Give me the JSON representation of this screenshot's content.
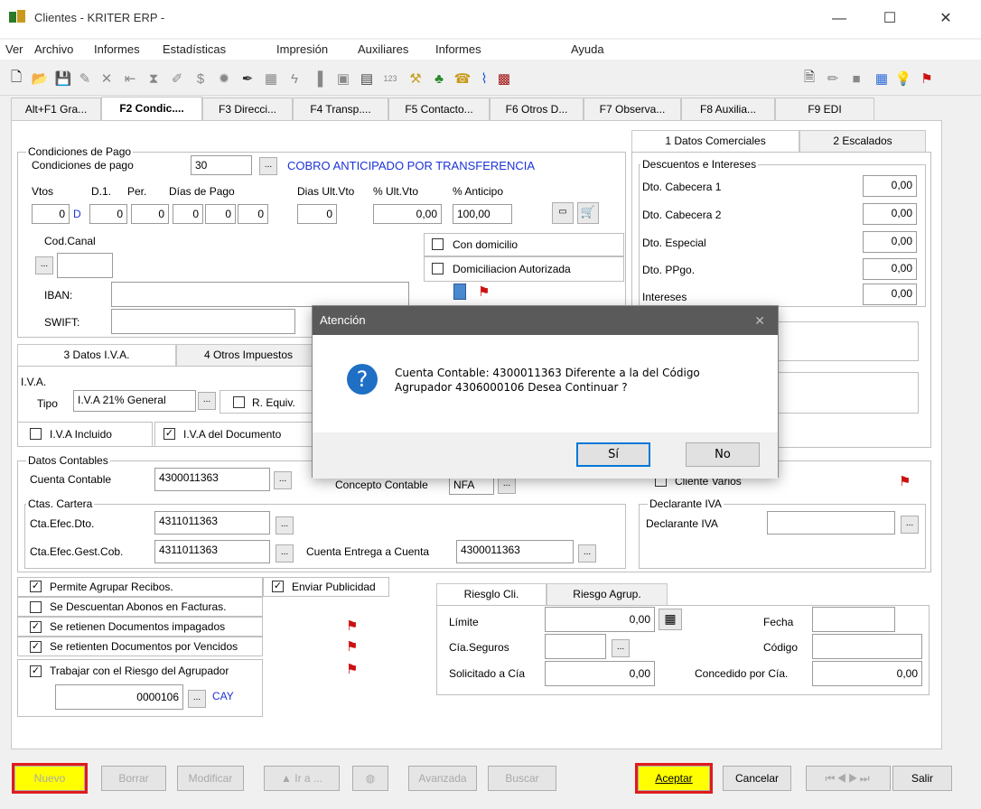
{
  "window": {
    "title": "Clientes - KRITER ERP -"
  },
  "menu": [
    "Ver",
    "Archivo",
    "Informes",
    "Estadísticas",
    "Impresión",
    "Auxiliares",
    "Informes",
    "Ayuda"
  ],
  "tabs": [
    "Alt+F1 Gra...",
    "F2 Condic....",
    "F3 Direcci...",
    "F4 Transp....",
    "F5 Contacto...",
    "F6 Otros D...",
    "F7 Observa...",
    "F8 Auxilia...",
    "F9 EDI"
  ],
  "condiciones": {
    "legend": "Condiciones de Pago",
    "label": "Condiciones de pago",
    "code": "30",
    "desc": "COBRO ANTICIPADO POR TRANSFERENCIA",
    "vtos_label": "Vtos",
    "d1_label": "D.1.",
    "per_label": "Per.",
    "dias_label": "Días de Pago",
    "ultvto_label": "Dias Ult.Vto",
    "pctultvto_label": "% Ult.Vto",
    "anticipo_label": "% Anticipo",
    "vtos": "0",
    "d_flag": "D",
    "d1": "0",
    "per": "0",
    "dias1": "0",
    "dias2": "0",
    "dias3": "0",
    "ultvto": "0",
    "pctultvto": "0,00",
    "anticipo": "100,00",
    "codcanal_label": "Cod.Canal",
    "con_domicilio": "Con domicilio",
    "domiciliacion": "Domiciliacion Autorizada",
    "iban_label": "IBAN:",
    "swift_label": "SWIFT:"
  },
  "comerciales": {
    "tab1": "1 Datos Comerciales",
    "tab2": "2 Escalados",
    "legend": "Descuentos e Intereses",
    "rows": [
      {
        "label": "Dto. Cabecera 1",
        "value": "0,00"
      },
      {
        "label": "Dto. Cabecera 2",
        "value": "0,00"
      },
      {
        "label": "Dto. Especial",
        "value": "0,00"
      },
      {
        "label": "Dto. PPgo.",
        "value": "0,00"
      },
      {
        "label": "Intereses",
        "value": "0,00"
      }
    ]
  },
  "iva": {
    "tab3": "3 Datos I.V.A.",
    "tab4": "4 Otros Impuestos",
    "legend": "I.V.A.",
    "tipo_label": "Tipo",
    "tipo": "I.V.A 21% General",
    "requiv": "R. Equiv.",
    "incluido": "I.V.A Incluido",
    "documento": "I.V.A del Documento"
  },
  "contables": {
    "legend": "Datos Contables",
    "cuenta_label": "Cuenta Contable",
    "cuenta": "4300011363",
    "concepto_label": "Concepto Contable",
    "concepto": "NFA",
    "cartera_legend": "Ctas. Cartera",
    "efec_dto_label": "Cta.Efec.Dto.",
    "efec_dto": "4311011363",
    "gest_cob_label": "Cta.Efec.Gest.Cob.",
    "gest_cob": "4311011363",
    "entrega_label": "Cuenta Entrega a Cuenta",
    "entrega": "4300011363",
    "cliente_varios": "Cliente Varios",
    "declarante_legend": "Declarante IVA",
    "declarante_label": "Declarante IVA"
  },
  "opciones": {
    "agrupar": "Permite Agrupar Recibos.",
    "publicidad": "Enviar Publicidad",
    "abonos": "Se Descuentan Abonos en Facturas.",
    "impagados": "Se retienen Documentos impagados",
    "vencidos": "Se retienten Documentos por Vencidos",
    "riesgo_agrupador": "Trabajar con el Riesgo del Agrupador",
    "agrupador_code": "0000106",
    "agrupador_name": "CAY"
  },
  "riesgo": {
    "tab1": "Riesglo Cli.",
    "tab2": "Riesgo Agrup.",
    "limite_label": "Límite",
    "limite": "0,00",
    "seguros_label": "Cía.Seguros",
    "solicitado_label": "Solicitado a Cía",
    "solicitado": "0,00",
    "fecha_label": "Fecha",
    "codigo_label": "Código",
    "concedido_label": "Concedido por Cía.",
    "concedido": "0,00"
  },
  "bottom": {
    "nuevo": "Nuevo",
    "borrar": "Borrar",
    "modificar": "Modificar",
    "ira": "Ir a ...",
    "avanzada": "Avanzada",
    "buscar": "Buscar",
    "aceptar": "Aceptar",
    "cancelar": "Cancelar",
    "salir": "Salir"
  },
  "dialog": {
    "title": "Atención",
    "line1": "Cuenta Contable:  4300011363 Diferente a la del Código",
    "line2": "Agrupador 4306000106 Desea Continuar ?",
    "yes": "Sí",
    "no": "No"
  },
  "colors": {
    "link_blue": "#1c32d8",
    "highlight": "#e01b1b",
    "yellow": "#ffff00"
  }
}
